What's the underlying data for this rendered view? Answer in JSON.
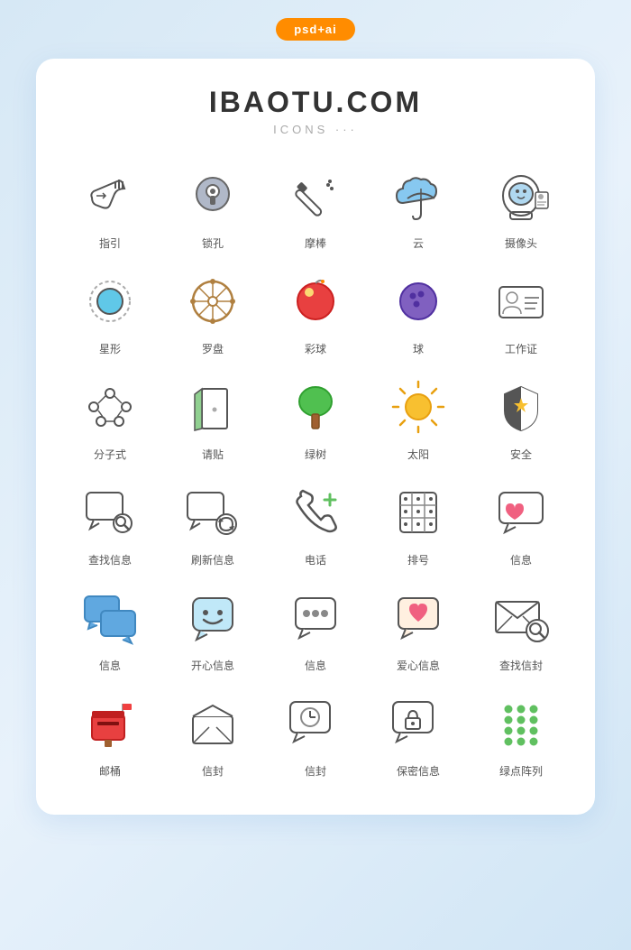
{
  "badge": "psd+ai",
  "header": {
    "title": "IBAOTU.COM",
    "subtitle": "ICONS ···"
  },
  "icons": [
    {
      "id": "zhiyin",
      "label": "指引"
    },
    {
      "id": "suokong",
      "label": "锁孔"
    },
    {
      "id": "mochai",
      "label": "摩棒"
    },
    {
      "id": "yun",
      "label": "云"
    },
    {
      "id": "shexiangtou",
      "label": "摄像头"
    },
    {
      "id": "xinxing",
      "label": "星形"
    },
    {
      "id": "luopan",
      "label": "罗盘"
    },
    {
      "id": "caiqiu",
      "label": "彩球"
    },
    {
      "id": "qiu",
      "label": "球"
    },
    {
      "id": "gongzuozheng",
      "label": "工作证"
    },
    {
      "id": "fenzishi",
      "label": "分子式"
    },
    {
      "id": "qingtie",
      "label": "请贴"
    },
    {
      "id": "lyshu",
      "label": "绿树"
    },
    {
      "id": "taiyang",
      "label": "太阳"
    },
    {
      "id": "anquan",
      "label": "安全"
    },
    {
      "id": "chazhao",
      "label": "查找信息"
    },
    {
      "id": "shuaxin",
      "label": "刷新信息"
    },
    {
      "id": "dianhua",
      "label": "电话"
    },
    {
      "id": "paihao",
      "label": "排号"
    },
    {
      "id": "xinxi",
      "label": "信息"
    },
    {
      "id": "xinxi2",
      "label": "信息"
    },
    {
      "id": "kaixin",
      "label": "开心信息"
    },
    {
      "id": "xinxi3",
      "label": "信息"
    },
    {
      "id": "aixin",
      "label": "爱心信息"
    },
    {
      "id": "chafengeng",
      "label": "查找信封"
    },
    {
      "id": "youtong",
      "label": "邮桶"
    },
    {
      "id": "xinfeng",
      "label": "信封"
    },
    {
      "id": "xinfeng2",
      "label": "信封"
    },
    {
      "id": "baomi",
      "label": "保密信息"
    },
    {
      "id": "ludian",
      "label": "绿点阵列"
    }
  ]
}
